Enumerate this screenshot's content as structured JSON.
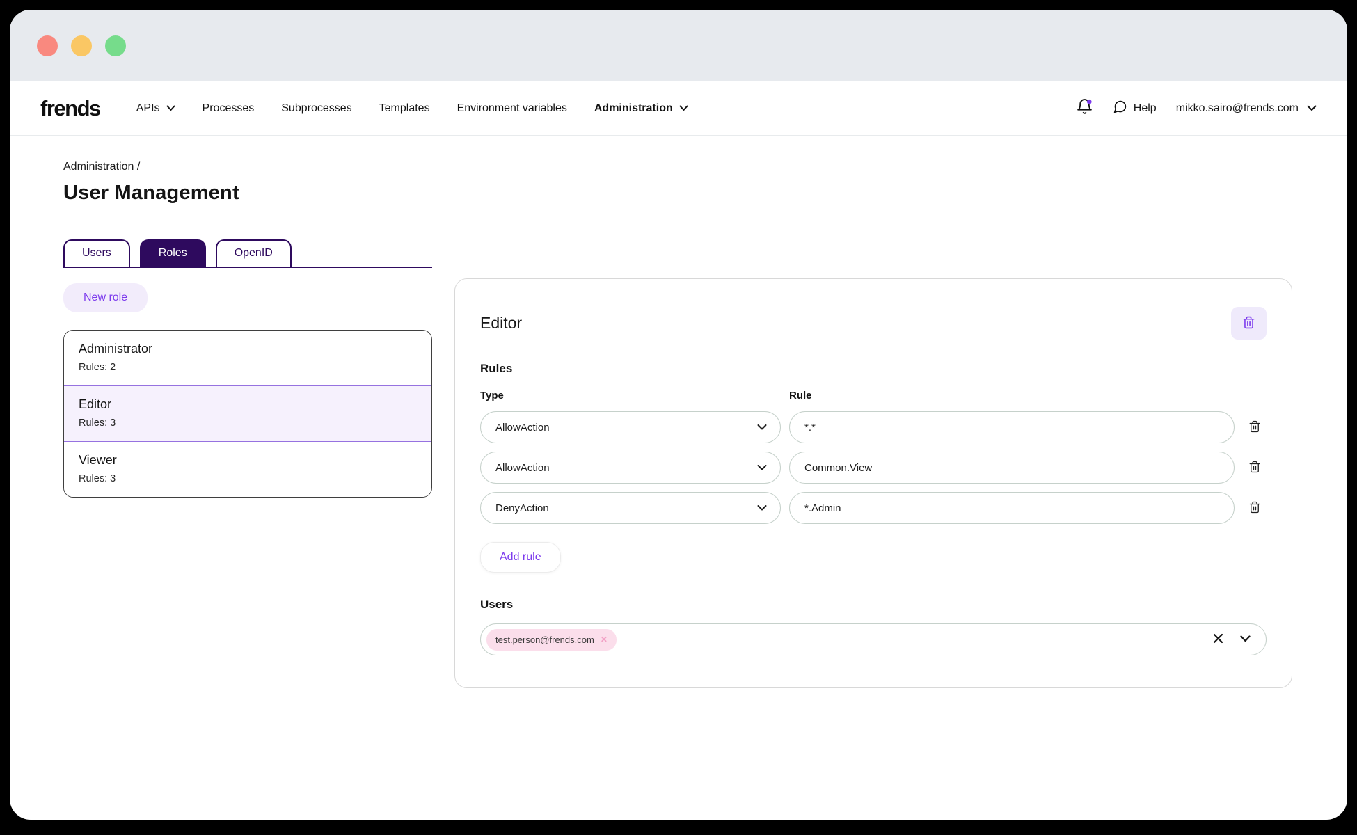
{
  "navbar": {
    "logo": "frends",
    "items": [
      {
        "label": "APIs"
      },
      {
        "label": "Processes"
      },
      {
        "label": "Subprocesses"
      },
      {
        "label": "Templates"
      },
      {
        "label": "Environment variables"
      },
      {
        "label": "Administration"
      }
    ],
    "help_label": "Help",
    "user_email": "mikko.sairo@frends.com"
  },
  "breadcrumb": "Administration /",
  "page_title": "User Management",
  "tabs": [
    {
      "label": "Users"
    },
    {
      "label": "Roles"
    },
    {
      "label": "OpenID"
    }
  ],
  "roles_section": {
    "new_role_label": "New role",
    "roles": [
      {
        "name": "Administrator",
        "rules_count": "Rules: 2"
      },
      {
        "name": "Editor",
        "rules_count": "Rules: 3"
      },
      {
        "name": "Viewer",
        "rules_count": "Rules: 3"
      }
    ]
  },
  "panel": {
    "title": "Editor",
    "rules_label": "Rules",
    "type_header": "Type",
    "rule_header": "Rule",
    "rules": [
      {
        "type": "AllowAction",
        "rule": "*.*"
      },
      {
        "type": "AllowAction",
        "rule": "Common.View"
      },
      {
        "type": "DenyAction",
        "rule": "*.Admin"
      }
    ],
    "add_rule_label": "Add rule",
    "users_label": "Users",
    "user_chips": [
      "test.person@frends.com"
    ]
  },
  "colors": {
    "tab_purple": "#2e0a5e",
    "accent_purple": "#7c3aed",
    "lavender_bg": "#f2ecfb",
    "selected_row_bg": "#f6f1fd",
    "chip_pink_bg": "#fbdeeb",
    "input_border": "#c6d1cb",
    "titlebar_gray": "#e7eaee",
    "traffic_red": "#f9897f",
    "traffic_yellow": "#fac764",
    "traffic_green": "#76dc8b"
  }
}
